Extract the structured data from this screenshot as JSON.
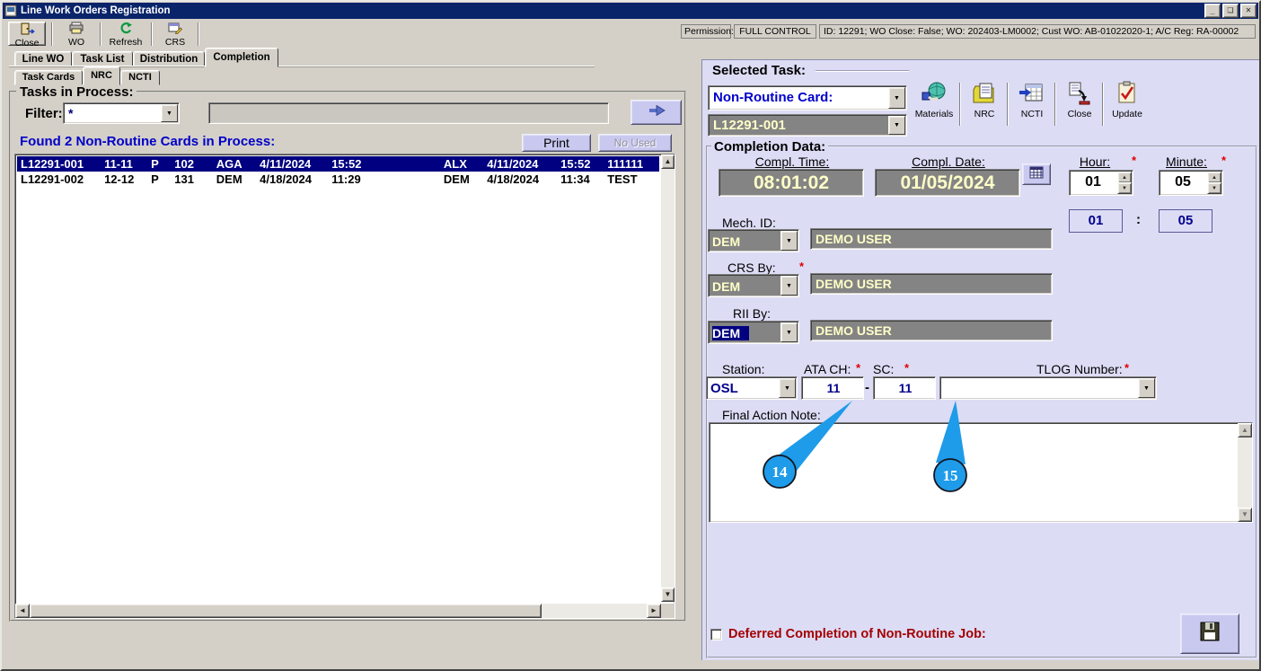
{
  "window": {
    "title": "Line Work Orders Registration",
    "minimize_glyph": "_",
    "restore_glyph": "❏",
    "close_glyph": "✕"
  },
  "icons": {
    "dropdown": "▼",
    "spinner_up": "▲",
    "spinner_down": "▼",
    "scroll_left": "◄",
    "scroll_right": "►",
    "scroll_up": "▲",
    "scroll_down": "▼"
  },
  "toolbar": {
    "items": [
      {
        "label": "Close"
      },
      {
        "label": "WO"
      },
      {
        "label": "Refresh"
      },
      {
        "label": "CRS"
      }
    ]
  },
  "permission": {
    "label": "Permission:",
    "level": "FULL CONTROL",
    "details": "ID: 12291; WO Close: False; WO: 202403-LM0002; Cust WO: AB-01022020-1; A/C Reg: RA-00002"
  },
  "tabs": {
    "main": [
      "Line WO",
      "Task List",
      "Distribution",
      "Completion"
    ],
    "active_main": "Completion",
    "sub": [
      "Task Cards",
      "NRC",
      "NCTI"
    ],
    "active_sub": "NRC"
  },
  "tasks": {
    "group_title": "Tasks in Process:",
    "filter_label": "Filter:",
    "filter_value": "*",
    "found_text": "Found 2 Non-Routine Cards in Process:",
    "print_label": "Print",
    "no_used_label": "No Used",
    "rows": [
      {
        "cells": [
          "L12291-001",
          "11-11",
          "P",
          "102",
          "AGA",
          "4/11/2024",
          "15:52",
          "ALX",
          "4/11/2024",
          "15:52",
          "111111"
        ],
        "selected": true
      },
      {
        "cells": [
          "L12291-002",
          "12-12",
          "P",
          "131",
          "DEM",
          "4/18/2024",
          "11:29",
          "DEM",
          "4/18/2024",
          "11:34",
          "TEST"
        ],
        "selected": false
      }
    ]
  },
  "selected_task": {
    "group_title": "Selected Task:",
    "type_value": "Non-Routine Card:",
    "card_value": "L12291-001",
    "tools": [
      {
        "label": "Materials"
      },
      {
        "label": "NRC"
      },
      {
        "label": "NCTI"
      },
      {
        "label": "Close"
      },
      {
        "label": "Update"
      }
    ]
  },
  "completion": {
    "group_title": "Completion Data:",
    "time_label": "Compl. Time:",
    "time_value": "08:01:02",
    "date_label": "Compl. Date:",
    "date_value": "01/05/2024",
    "hour_label": "Hour:",
    "hour_value": "01",
    "minute_label": "Minute:",
    "minute_value": "05",
    "required_marker": "*",
    "hour_display": "01",
    "minute_display": "05",
    "time_separator": ":",
    "mech_label": "Mech. ID:",
    "mech_code": "DEM",
    "mech_name": "DEMO USER",
    "crs_label": "CRS By:",
    "crs_code": "DEM",
    "crs_name": "DEMO USER",
    "rii_label": "RII By:",
    "rii_code": "DEM",
    "rii_name": "DEMO USER",
    "station_label": "Station:",
    "station_value": "OSL",
    "ata_label": "ATA CH:",
    "ata_value": "11",
    "ata_sc_separator": "-",
    "sc_label": "SC:",
    "sc_value": "11",
    "tlog_label": "TLOG Number:",
    "tlog_value": "",
    "note_label": "Final Action Note:",
    "note_value": "",
    "deferred_label": "Deferred Completion of Non-Routine Job:",
    "callouts": [
      "14",
      "15"
    ]
  },
  "colors": {
    "titlebar": "#0a246a",
    "chrome": "#d4d0c8",
    "panel_lavender": "#dcdcf5",
    "button_lavender": "#c9c9f0",
    "field_gray": "#848484",
    "field_text_yellow": "#ffffc8",
    "accent_blue": "#0000c8",
    "value_navy": "#00008b",
    "selected_row": "#000080",
    "alert_red": "#a50000",
    "asterisk_red": "#e00000",
    "callout_blue": "#1e9be9"
  }
}
